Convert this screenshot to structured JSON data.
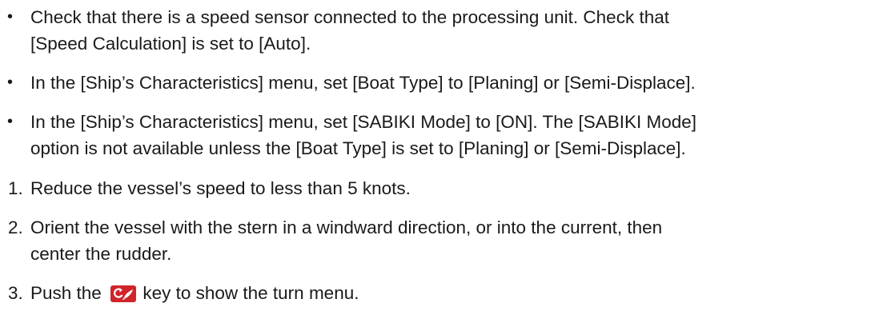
{
  "bullets": [
    {
      "marker": "•",
      "text": "Check that there is a speed sensor connected to the processing unit. Check that\n[Speed Calculation] is set to [Auto]."
    },
    {
      "marker": "•",
      "text": "In the [Ship’s Characteristics] menu, set [Boat Type] to [Planing] or [Semi-Displace]."
    },
    {
      "marker": "•",
      "text": "In the [Ship’s Characteristics] menu, set [SABIKI Mode] to [ON]. The [SABIKI Mode]\noption is not available unless the [Boat Type] is set to [Planing] or [Semi-Displace]."
    }
  ],
  "steps": [
    {
      "marker": "1.",
      "text": "Reduce the vessel’s speed to less than 5 knots."
    },
    {
      "marker": "2.",
      "text": "Orient the vessel with the stern in a windward direction, or into the current, then\ncenter the rudder."
    },
    {
      "marker": "3.",
      "text_before": "Push the",
      "icon": "turn-key-icon",
      "text_after": "key to show the turn menu."
    }
  ],
  "colors": {
    "text": "#1a1a1a",
    "icon_background": "#d0242b",
    "icon_foreground": "#ffffff"
  }
}
